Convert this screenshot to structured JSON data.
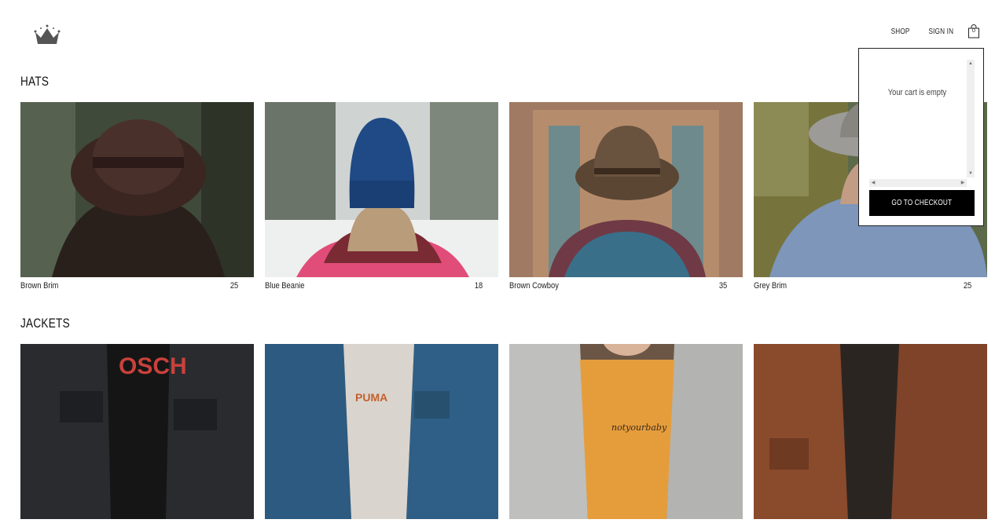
{
  "header": {
    "nav": {
      "shop_label": "SHOP",
      "signin_label": "SIGN IN",
      "cart_count": "0"
    }
  },
  "sections": [
    {
      "title": "HATS",
      "items": [
        {
          "name": "Brown Brim",
          "price": "25"
        },
        {
          "name": "Blue Beanie",
          "price": "18"
        },
        {
          "name": "Brown Cowboy",
          "price": "35"
        },
        {
          "name": "Grey Brim",
          "price": "25"
        }
      ]
    },
    {
      "title": "JACKETS",
      "items": [
        {
          "name": "",
          "price": ""
        },
        {
          "name": "",
          "price": ""
        },
        {
          "name": "",
          "price": ""
        },
        {
          "name": "",
          "price": ""
        }
      ]
    }
  ],
  "cart": {
    "empty_message": "Your cart is empty",
    "checkout_label": "GO TO CHECKOUT"
  },
  "icons": {
    "logo": "crown-icon",
    "cart": "shopping-bag-icon"
  }
}
